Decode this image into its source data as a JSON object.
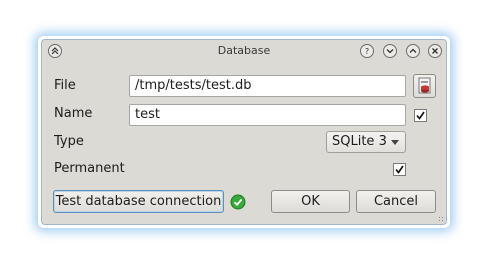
{
  "window": {
    "title": "Database",
    "titlebar_buttons": [
      "shade-icon",
      "help-icon",
      "minimize-icon",
      "maximize-icon",
      "close-icon"
    ]
  },
  "form": {
    "file": {
      "label": "File",
      "value": "/tmp/tests/test.db",
      "browse_icon": "database-file-icon"
    },
    "name": {
      "label": "Name",
      "value": "test",
      "checked": true
    },
    "type": {
      "label": "Type",
      "selected": "SQLite 3"
    },
    "permanent": {
      "label": "Permanent",
      "checked": true
    }
  },
  "buttons": {
    "test_connection": "Test database connection",
    "ok": "OK",
    "cancel": "Cancel"
  },
  "status": {
    "connection_ok_icon": "check-circle-icon",
    "color": "#2e9b2e"
  },
  "colors": {
    "window_bg": "#dcdad5",
    "glow": "#60aaeb"
  }
}
